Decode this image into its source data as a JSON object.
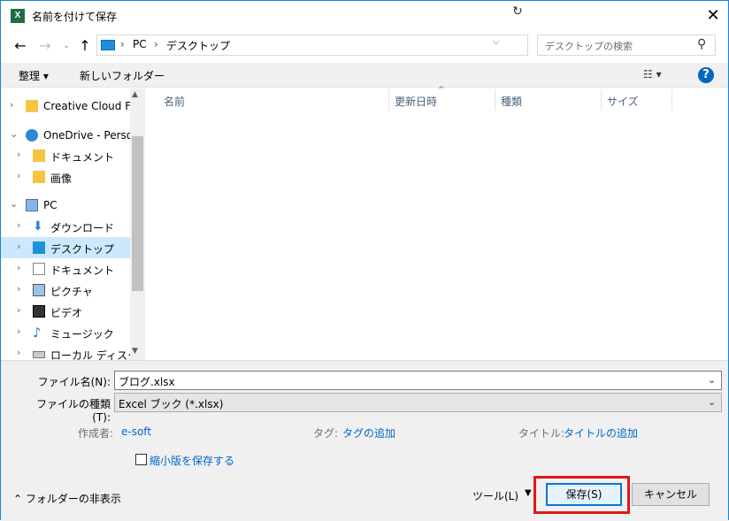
{
  "window": {
    "title": "名前を付けて保存",
    "app_icon": "X",
    "close": "✕"
  },
  "address": {
    "crumbs": [
      "PC",
      "デスクトップ"
    ],
    "search_placeholder": "デスクトップの検索"
  },
  "toolbar": {
    "organize": "整理 ▾",
    "new_folder": "新しいフォルダー"
  },
  "nav": {
    "items": [
      {
        "label": "Creative Cloud File",
        "icon": "creative-cloud-folder-icon"
      },
      {
        "label": "OneDrive - Persona",
        "icon": "onedrive-icon"
      },
      {
        "label": "ドキュメント",
        "icon": "folder-icon"
      },
      {
        "label": "画像",
        "icon": "folder-icon"
      },
      {
        "label": "PC",
        "icon": "pc-icon"
      },
      {
        "label": "ダウンロード",
        "icon": "download-icon"
      },
      {
        "label": "デスクトップ",
        "icon": "desktop-icon"
      },
      {
        "label": "ドキュメント",
        "icon": "document-icon"
      },
      {
        "label": "ピクチャ",
        "icon": "pictures-icon"
      },
      {
        "label": "ビデオ",
        "icon": "video-icon"
      },
      {
        "label": "ミュージック",
        "icon": "music-icon"
      },
      {
        "label": "ローカル ディスク (C:",
        "icon": "drive-icon"
      }
    ]
  },
  "columns": [
    "名前",
    "更新日時",
    "種類",
    "サイズ"
  ],
  "form": {
    "filename_label": "ファイル名(N):",
    "filename_value": "ブログ.xlsx",
    "filetype_label": "ファイルの種類(T):",
    "filetype_value": "Excel ブック (*.xlsx)",
    "author_label": "作成者:",
    "author_value": "e-soft",
    "tag_label": "タグ:",
    "tag_value": "タグの追加",
    "title_label": "タイトル:",
    "title_value": "タイトルの追加",
    "thumbnail_label": "縮小版を保存する",
    "hide_folders": "フォルダーの非表示",
    "tools": "ツール(L)",
    "save": "保存(S)",
    "cancel": "キャンセル"
  },
  "colors": {
    "accent": "#0078d7",
    "highlight": "#e01818",
    "selected": "#cce8ff",
    "link": "#0066cc"
  }
}
